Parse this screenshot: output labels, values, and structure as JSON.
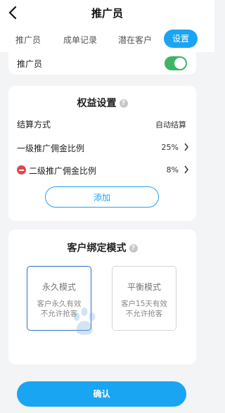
{
  "header": {
    "title": "推广员"
  },
  "tabs": [
    {
      "label": "推广员"
    },
    {
      "label": "成单记录"
    },
    {
      "label": "潜在客户"
    },
    {
      "label": "设置"
    }
  ],
  "promoter_row": {
    "label": "推广员",
    "toggle_on": true
  },
  "rights": {
    "title": "权益设置",
    "settlement_label": "结算方式",
    "settlement_value": "自动结算",
    "level1_label": "一级推广佣金比例",
    "level1_value": "25%",
    "level2_label": "二级推广佣金比例",
    "level2_value": "8%",
    "add_label": "添加"
  },
  "binding": {
    "title": "客户绑定模式",
    "modes": [
      {
        "title": "永久模式",
        "desc1": "客户永久有效",
        "desc2": "不允许抢客",
        "selected": true
      },
      {
        "title": "平衡模式",
        "desc1": "客户15天有效",
        "desc2": "不允许抢客",
        "selected": false
      }
    ]
  },
  "confirm_label": "确认",
  "colors": {
    "accent": "#1aa5f2",
    "toggle_on": "#3db565",
    "danger": "#e0474c"
  }
}
